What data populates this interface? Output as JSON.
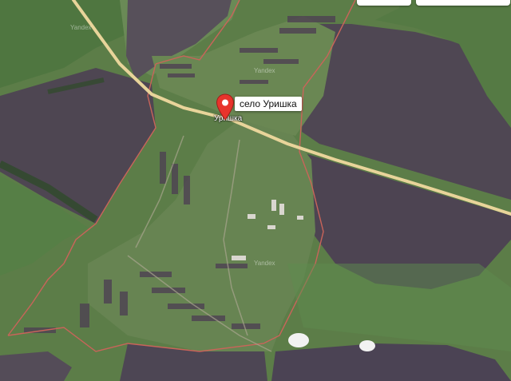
{
  "map": {
    "marker_label": "село Уришка",
    "village_label": "Уришка",
    "road_label": "",
    "watermark": "Yandex"
  },
  "colors": {
    "field_dark": "#4e4652",
    "field_green": "#5f8a4c",
    "road": "#e8d49a",
    "boundary": "#c9645a",
    "marker": "#e8342c"
  },
  "icons": {
    "marker": "map-pin-icon"
  }
}
